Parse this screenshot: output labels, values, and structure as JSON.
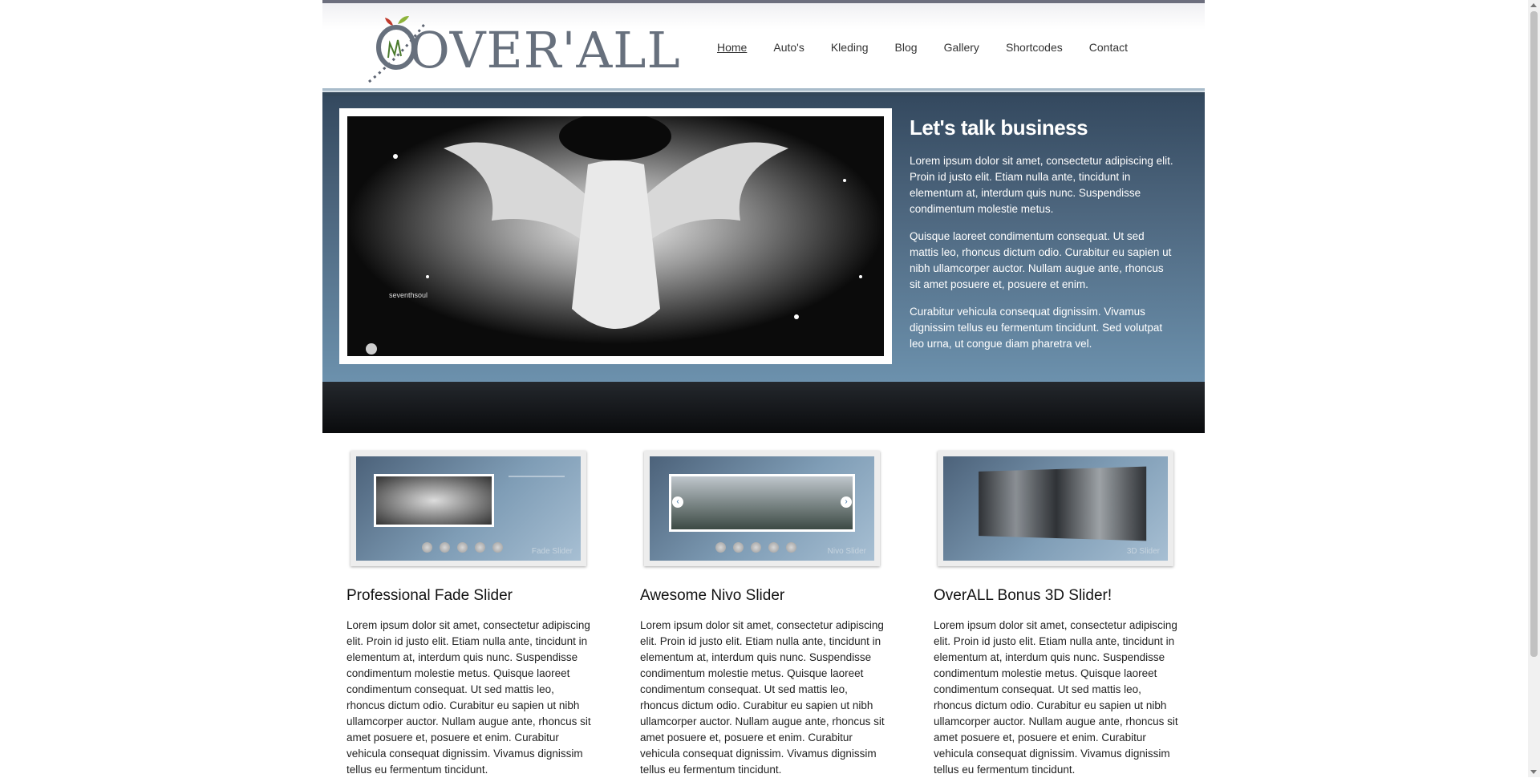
{
  "header": {
    "logo_text": "OVER'ALL",
    "nav": [
      {
        "label": "Home",
        "active": true
      },
      {
        "label": "Auto's",
        "active": false
      },
      {
        "label": "Kleding",
        "active": false
      },
      {
        "label": "Blog",
        "active": false
      },
      {
        "label": "Gallery",
        "active": false
      },
      {
        "label": "Shortcodes",
        "active": false
      },
      {
        "label": "Contact",
        "active": false
      }
    ]
  },
  "hero": {
    "title": "Let's talk business",
    "paragraphs": [
      "Lorem ipsum dolor sit amet, consectetur adipiscing elit. Proin id justo elit. Etiam nulla ante, tincidunt in elementum at, interdum quis nunc. Suspendisse condimentum molestie metus.",
      "Quisque laoreet condimentum consequat. Ut sed mattis leo, rhoncus dictum odio. Curabitur eu sapien ut nibh ullamcorper auctor. Nullam augue ante, rhoncus sit amet posuere et, posuere et enim.",
      "Curabitur vehicula consequat dignissim. Vivamus dignissim tellus eu fermentum tincidunt. Sed volutpat leo urna, ut congue diam pharetra vel."
    ],
    "image_watermark": "seventhsoul"
  },
  "features": [
    {
      "thumb_label": "Fade Slider",
      "title": "Professional Fade Slider",
      "text": "Lorem ipsum dolor sit amet, consectetur adipiscing elit. Proin id justo elit. Etiam nulla ante, tincidunt in elementum at, interdum quis nunc. Suspendisse condimentum molestie metus. Quisque laoreet condimentum consequat. Ut sed mattis leo, rhoncus dictum odio. Curabitur eu sapien ut nibh ullamcorper auctor. Nullam augue ante, rhoncus sit amet posuere et, posuere et enim. Curabitur vehicula consequat dignissim. Vivamus dignissim tellus eu fermentum tincidunt."
    },
    {
      "thumb_label": "Nivo Slider",
      "title": "Awesome Nivo Slider",
      "text": "Lorem ipsum dolor sit amet, consectetur adipiscing elit. Proin id justo elit. Etiam nulla ante, tincidunt in elementum at, interdum quis nunc. Suspendisse condimentum molestie metus. Quisque laoreet condimentum consequat. Ut sed mattis leo, rhoncus dictum odio. Curabitur eu sapien ut nibh ullamcorper auctor. Nullam augue ante, rhoncus sit amet posuere et, posuere et enim. Curabitur vehicula consequat dignissim. Vivamus dignissim tellus eu fermentum tincidunt."
    },
    {
      "thumb_label": "3D Slider",
      "title": "OverALL Bonus 3D Slider!",
      "text": "Lorem ipsum dolor sit amet, consectetur adipiscing elit. Proin id justo elit. Etiam nulla ante, tincidunt in elementum at, interdum quis nunc. Suspendisse condimentum molestie metus. Quisque laoreet condimentum consequat. Ut sed mattis leo, rhoncus dictum odio. Curabitur eu sapien ut nibh ullamcorper auctor. Nullam augue ante, rhoncus sit amet posuere et, posuere et enim. Curabitur vehicula consequat dignissim. Vivamus dignissim tellus eu fermentum tincidunt."
    }
  ]
}
